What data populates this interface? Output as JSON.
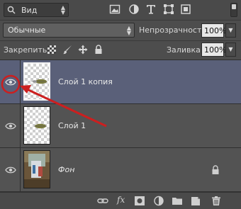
{
  "filter": {
    "kind_label": "Вид",
    "icons": [
      "image-filter-icon",
      "adjustment-filter-icon",
      "text-filter-icon",
      "shape-filter-icon",
      "smart-object-filter-icon"
    ]
  },
  "blend": {
    "mode": "Обычные",
    "opacity_label": "Непрозрачность:",
    "opacity_value": "100%"
  },
  "lock": {
    "label": "Закрепить:",
    "icons": [
      "lock-transparent-icon",
      "lock-paint-icon",
      "lock-move-icon",
      "lock-all-icon"
    ],
    "fill_label": "Заливка:",
    "fill_value": "100%"
  },
  "layers": [
    {
      "name": "Слой 1 копия",
      "selected": true,
      "visible": true,
      "locked": false
    },
    {
      "name": "Слой 1",
      "selected": false,
      "visible": true,
      "locked": false
    },
    {
      "name": "Фон",
      "selected": false,
      "visible": true,
      "locked": true
    }
  ],
  "bottom_bar": {
    "fx_label": "fx",
    "icons": [
      "link-icon",
      "fx-icon",
      "mask-icon",
      "adjustment-icon",
      "folder-icon",
      "new-layer-icon",
      "trash-icon"
    ]
  },
  "colors": {
    "panel_bg": "#535353",
    "selected_layer": "#5a6079",
    "annotation_red": "#cc1f1f"
  }
}
